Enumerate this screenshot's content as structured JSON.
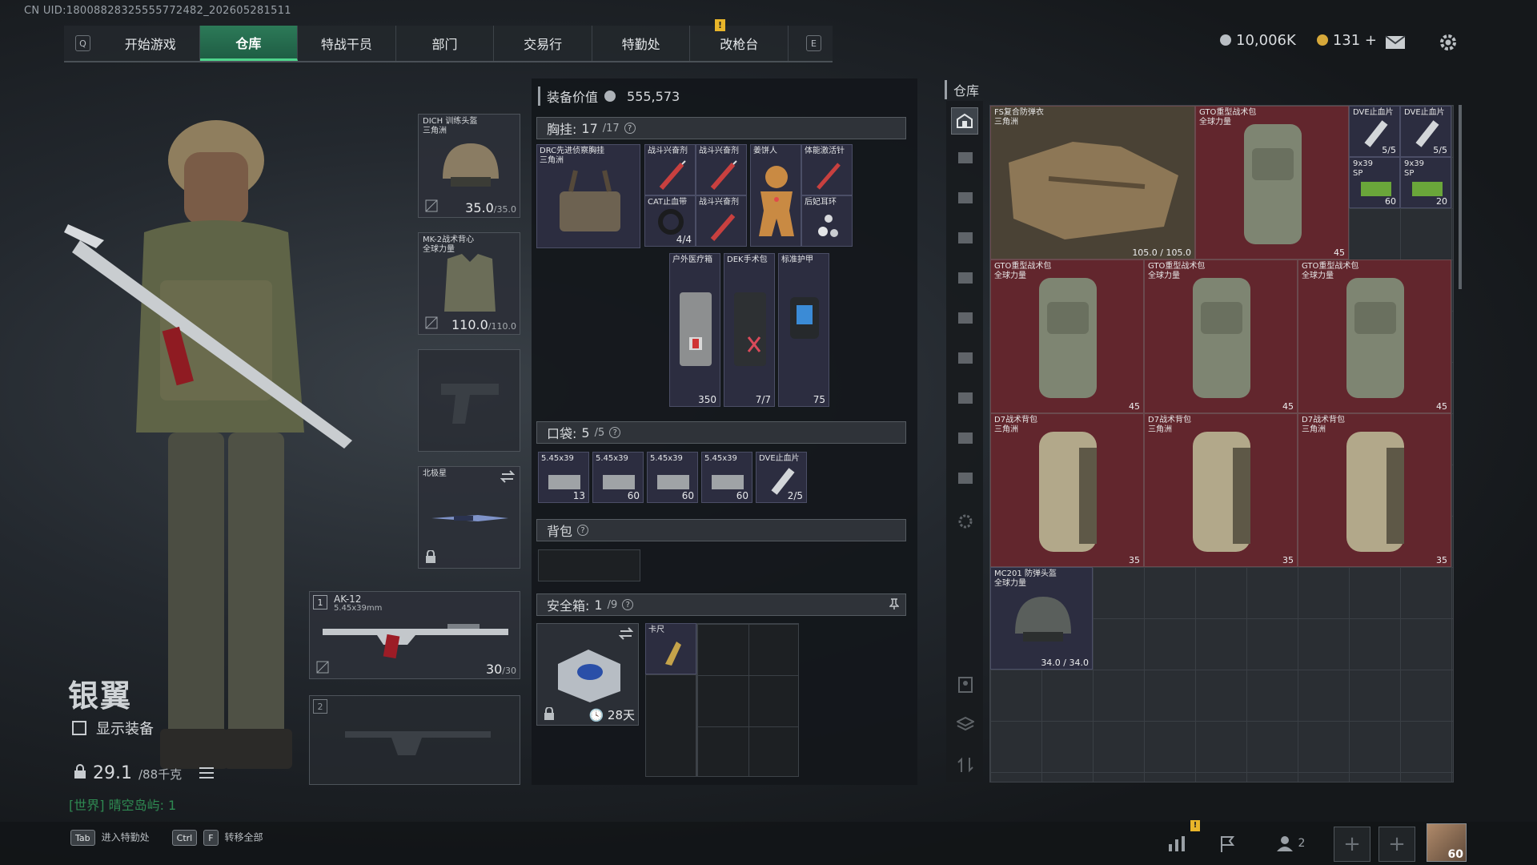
{
  "uid_text": "CN UID:180088283255557724​82_202605281511",
  "nav": {
    "left_key": "Q",
    "right_key": "E",
    "tabs": [
      "开始游戏",
      "仓库",
      "特战干员",
      "部门",
      "交易行",
      "特勤处",
      "改枪台"
    ],
    "tab_alert": "!"
  },
  "currency": {
    "silver": "10,006K",
    "gold": "131",
    "plus": "+"
  },
  "operator": {
    "name": "银翼",
    "show_equipment": "显示装备",
    "weight": "29.1",
    "weight_max": "/88千克",
    "region": "[世界] 晴空岛屿: 1"
  },
  "bottom_keys": {
    "tab_key": "Tab",
    "tab_label": "进入特勤处",
    "ctrl_key": "Ctrl",
    "f_key": "F",
    "ctrl_label": "转移全部"
  },
  "slots": {
    "helmet": {
      "name": "DICH 训练头盔",
      "sub": "三角洲",
      "dur": "35.0",
      "dur_max": "/35.0"
    },
    "armor": {
      "name": "MK-2战术背心",
      "sub": "全球力量",
      "dur": "110.0",
      "dur_max": "/110.0"
    },
    "melee": {
      "name": "北极星"
    },
    "primary": {
      "index": "1",
      "name": "AK-12",
      "caliber": "5.45x39mm",
      "ammo": "30",
      "ammo_max": "/30"
    },
    "secondary": {
      "index": "2"
    }
  },
  "equipment_value": {
    "label": "装备价值",
    "value": "555,573"
  },
  "chest_rig": {
    "label": "胸挂:",
    "count": "17",
    "max": "/17",
    "q": "?",
    "item": {
      "name": "DRC先进侦察胸挂",
      "sub": "三角洲"
    }
  },
  "rig_items": [
    {
      "name": "战斗兴奋剂",
      "cnt": ""
    },
    {
      "name": "战斗兴奋剂",
      "cnt": ""
    },
    {
      "name": "姜饼人",
      "cnt": ""
    },
    {
      "name": "体能激活针",
      "cnt": ""
    },
    {
      "name": "CAT止血带",
      "cnt": "4/4"
    },
    {
      "name": "战斗兴奋剂",
      "cnt": ""
    },
    {
      "name": "后妃耳环",
      "cnt": ""
    },
    {
      "name": "户外医疗箱",
      "cnt": "350"
    },
    {
      "name": "DEK手术包",
      "cnt": "7/7"
    },
    {
      "name": "标准护甲",
      "cnt": "75"
    }
  ],
  "pocket": {
    "label": "口袋:",
    "count": "5",
    "max": "/5",
    "q": "?",
    "items": [
      {
        "name": "5.45x39",
        "cnt": "13"
      },
      {
        "name": "5.45x39",
        "cnt": "60"
      },
      {
        "name": "5.45x39",
        "cnt": "60"
      },
      {
        "name": "5.45x39",
        "cnt": "60"
      },
      {
        "name": "DVE止血片",
        "cnt": "2/5"
      }
    ]
  },
  "backpack": {
    "label": "背包",
    "q": "?"
  },
  "safebox": {
    "label": "安全箱:",
    "count": "1",
    "max": "/9",
    "q": "?",
    "timer": "28天",
    "item": {
      "name": "卡尺"
    }
  },
  "warehouse": {
    "title": "仓库",
    "items": [
      {
        "name": "FS复合防弹衣",
        "sub": "三角洲",
        "cnt": "105.0 / 105.0"
      },
      {
        "name": "GTO重型战术包",
        "sub": "全球力量",
        "cnt": "45"
      },
      {
        "name": "DVE止血片",
        "sub": "",
        "cnt": "5/5"
      },
      {
        "name": "DVE止血片",
        "sub": "",
        "cnt": "5/5"
      },
      {
        "name": "9x39",
        "sub": "SP",
        "cnt": "60"
      },
      {
        "name": "9x39",
        "sub": "SP",
        "cnt": "20"
      },
      {
        "name": "GTO重型战术包",
        "sub": "全球力量",
        "cnt": "45"
      },
      {
        "name": "GTO重型战术包",
        "sub": "全球力量",
        "cnt": "45"
      },
      {
        "name": "GTO重型战术包",
        "sub": "全球力量",
        "cnt": "45"
      },
      {
        "name": "D7战术背包",
        "sub": "三角洲",
        "cnt": "35"
      },
      {
        "name": "D7战术背包",
        "sub": "三角洲",
        "cnt": "35"
      },
      {
        "name": "D7战术背包",
        "sub": "三角洲",
        "cnt": "35"
      },
      {
        "name": "MC201 防弹头盔",
        "sub": "全球力量",
        "cnt": "34.0 / 34.0"
      }
    ]
  },
  "bottom": {
    "alert": "!",
    "friends": "2",
    "level": "60"
  },
  "colors": {
    "accent": "#4fd48c",
    "item_red": "#62262d",
    "item_purple": "#2c2d40"
  }
}
